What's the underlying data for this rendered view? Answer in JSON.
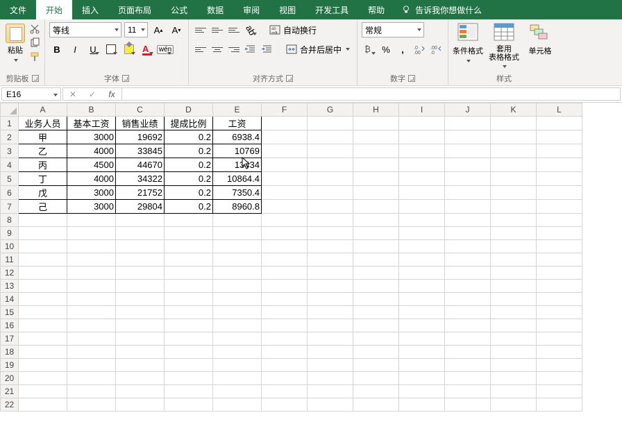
{
  "tabs": {
    "file": "文件",
    "home": "开始",
    "insert": "插入",
    "pagelayout": "页面布局",
    "formulas": "公式",
    "data": "数据",
    "review": "审阅",
    "view": "视图",
    "developer": "开发工具",
    "help": "帮助",
    "tellme": "告诉我你想做什么"
  },
  "ribbon": {
    "clipboard": {
      "paste": "粘贴",
      "label": "剪贴板"
    },
    "font": {
      "name": "等线",
      "size": "11",
      "label": "字体"
    },
    "alignment": {
      "wrap": "自动换行",
      "merge": "合并后居中",
      "label": "对齐方式"
    },
    "number": {
      "format": "常规",
      "label": "数字"
    },
    "styles": {
      "condfmt": "条件格式",
      "tablefmt": "套用\n表格格式",
      "cellstyle": "单元格",
      "label": "样式"
    }
  },
  "formulaBar": {
    "cellRef": "E16",
    "cancel": "✕",
    "confirm": "✓",
    "fx": "fx"
  },
  "sheet": {
    "columns": [
      "A",
      "B",
      "C",
      "D",
      "E",
      "F",
      "G",
      "H",
      "I",
      "J",
      "K",
      "L"
    ],
    "headers": [
      "业务人员",
      "基本工资",
      "销售业绩",
      "提成比例",
      "工资"
    ],
    "rows": [
      {
        "p": "甲",
        "base": "3000",
        "sales": "19692",
        "rate": "0.2",
        "wage": "6938.4"
      },
      {
        "p": "乙",
        "base": "4000",
        "sales": "33845",
        "rate": "0.2",
        "wage": "10769"
      },
      {
        "p": "丙",
        "base": "4500",
        "sales": "44670",
        "rate": "0.2",
        "wage": "13434"
      },
      {
        "p": "丁",
        "base": "4000",
        "sales": "34322",
        "rate": "0.2",
        "wage": "10864.4"
      },
      {
        "p": "戊",
        "base": "3000",
        "sales": "21752",
        "rate": "0.2",
        "wage": "7350.4"
      },
      {
        "p": "己",
        "base": "3000",
        "sales": "29804",
        "rate": "0.2",
        "wage": "8960.8"
      }
    ],
    "emptyRowsFrom": 8,
    "emptyRowsTo": 22
  },
  "chart_data": {
    "type": "table",
    "columns": [
      "业务人员",
      "基本工资",
      "销售业绩",
      "提成比例",
      "工资"
    ],
    "data": [
      [
        "甲",
        3000,
        19692,
        0.2,
        6938.4
      ],
      [
        "乙",
        4000,
        33845,
        0.2,
        10769
      ],
      [
        "丙",
        4500,
        44670,
        0.2,
        13434
      ],
      [
        "丁",
        4000,
        34322,
        0.2,
        10864.4
      ],
      [
        "戊",
        3000,
        21752,
        0.2,
        7350.4
      ],
      [
        "己",
        3000,
        29804,
        0.2,
        8960.8
      ]
    ]
  }
}
